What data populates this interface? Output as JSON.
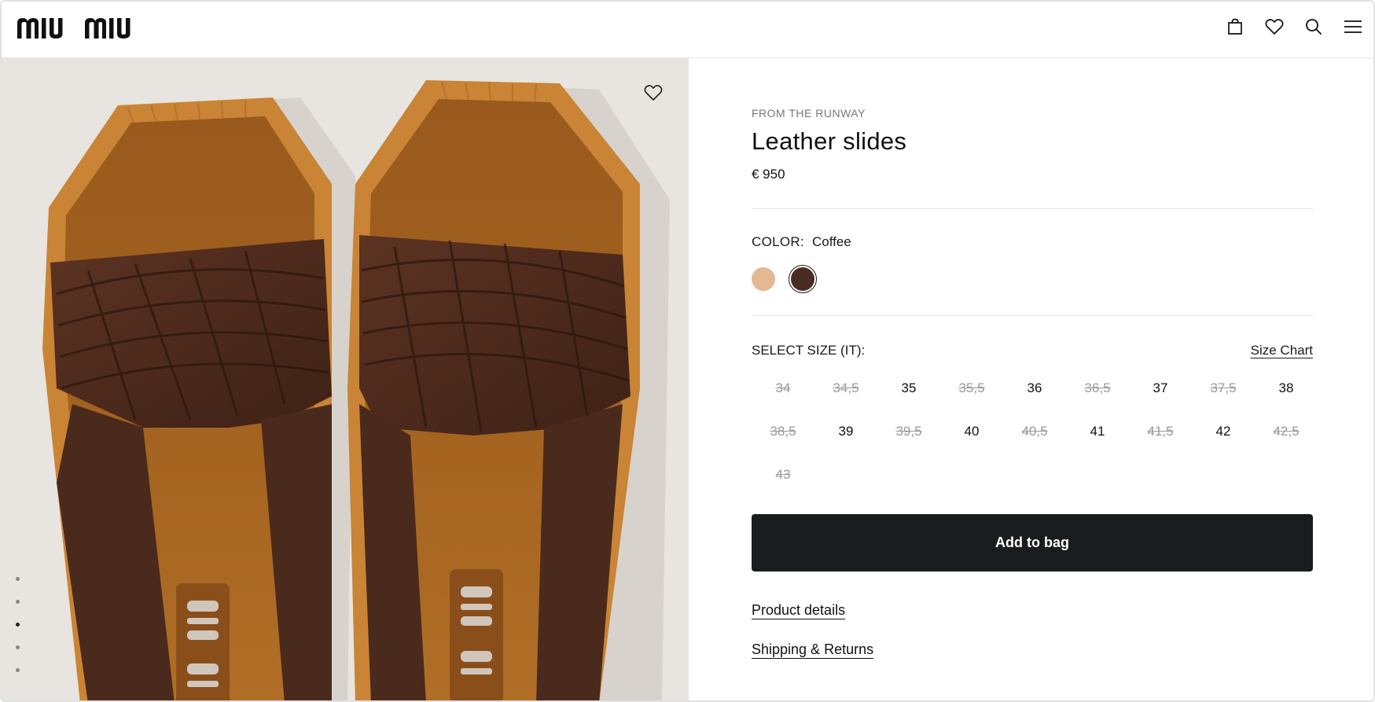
{
  "header": {
    "logo_text": "miu miu",
    "icons": [
      "shopping-bag-icon",
      "heart-icon",
      "search-icon",
      "menu-icon"
    ]
  },
  "gallery": {
    "image_description": "Leather slides",
    "wishlist_icon": "heart-outline-icon",
    "pager": {
      "count": 5,
      "active_index": 2
    }
  },
  "product": {
    "eyebrow": "FROM THE RUNWAY",
    "title": "Leather slides",
    "price": "€ 950",
    "color_label": "COLOR:",
    "color_value": "Coffee",
    "swatches": [
      {
        "name": "Nude",
        "hex": "#e3b893",
        "selected": false
      },
      {
        "name": "Coffee",
        "hex": "#4a2c24",
        "selected": true
      }
    ],
    "size_label": "SELECT SIZE (IT):",
    "size_chart_label": "Size Chart",
    "sizes": [
      {
        "label": "34",
        "available": false
      },
      {
        "label": "34,5",
        "available": false
      },
      {
        "label": "35",
        "available": true
      },
      {
        "label": "35,5",
        "available": false
      },
      {
        "label": "36",
        "available": true
      },
      {
        "label": "36,5",
        "available": false
      },
      {
        "label": "37",
        "available": true
      },
      {
        "label": "37,5",
        "available": false
      },
      {
        "label": "38",
        "available": true
      },
      {
        "label": "38,5",
        "available": false
      },
      {
        "label": "39",
        "available": true
      },
      {
        "label": "39,5",
        "available": false
      },
      {
        "label": "40",
        "available": true
      },
      {
        "label": "40,5",
        "available": false
      },
      {
        "label": "41",
        "available": true
      },
      {
        "label": "41,5",
        "available": false
      },
      {
        "label": "42",
        "available": true
      },
      {
        "label": "42,5",
        "available": false
      },
      {
        "label": "43",
        "available": false
      }
    ],
    "add_to_bag": "Add to bag",
    "links": [
      "Product details",
      "Shipping & Returns"
    ]
  },
  "colors": {
    "button_bg": "#1b1c1e",
    "gallery_bg": "#e8e4df"
  }
}
